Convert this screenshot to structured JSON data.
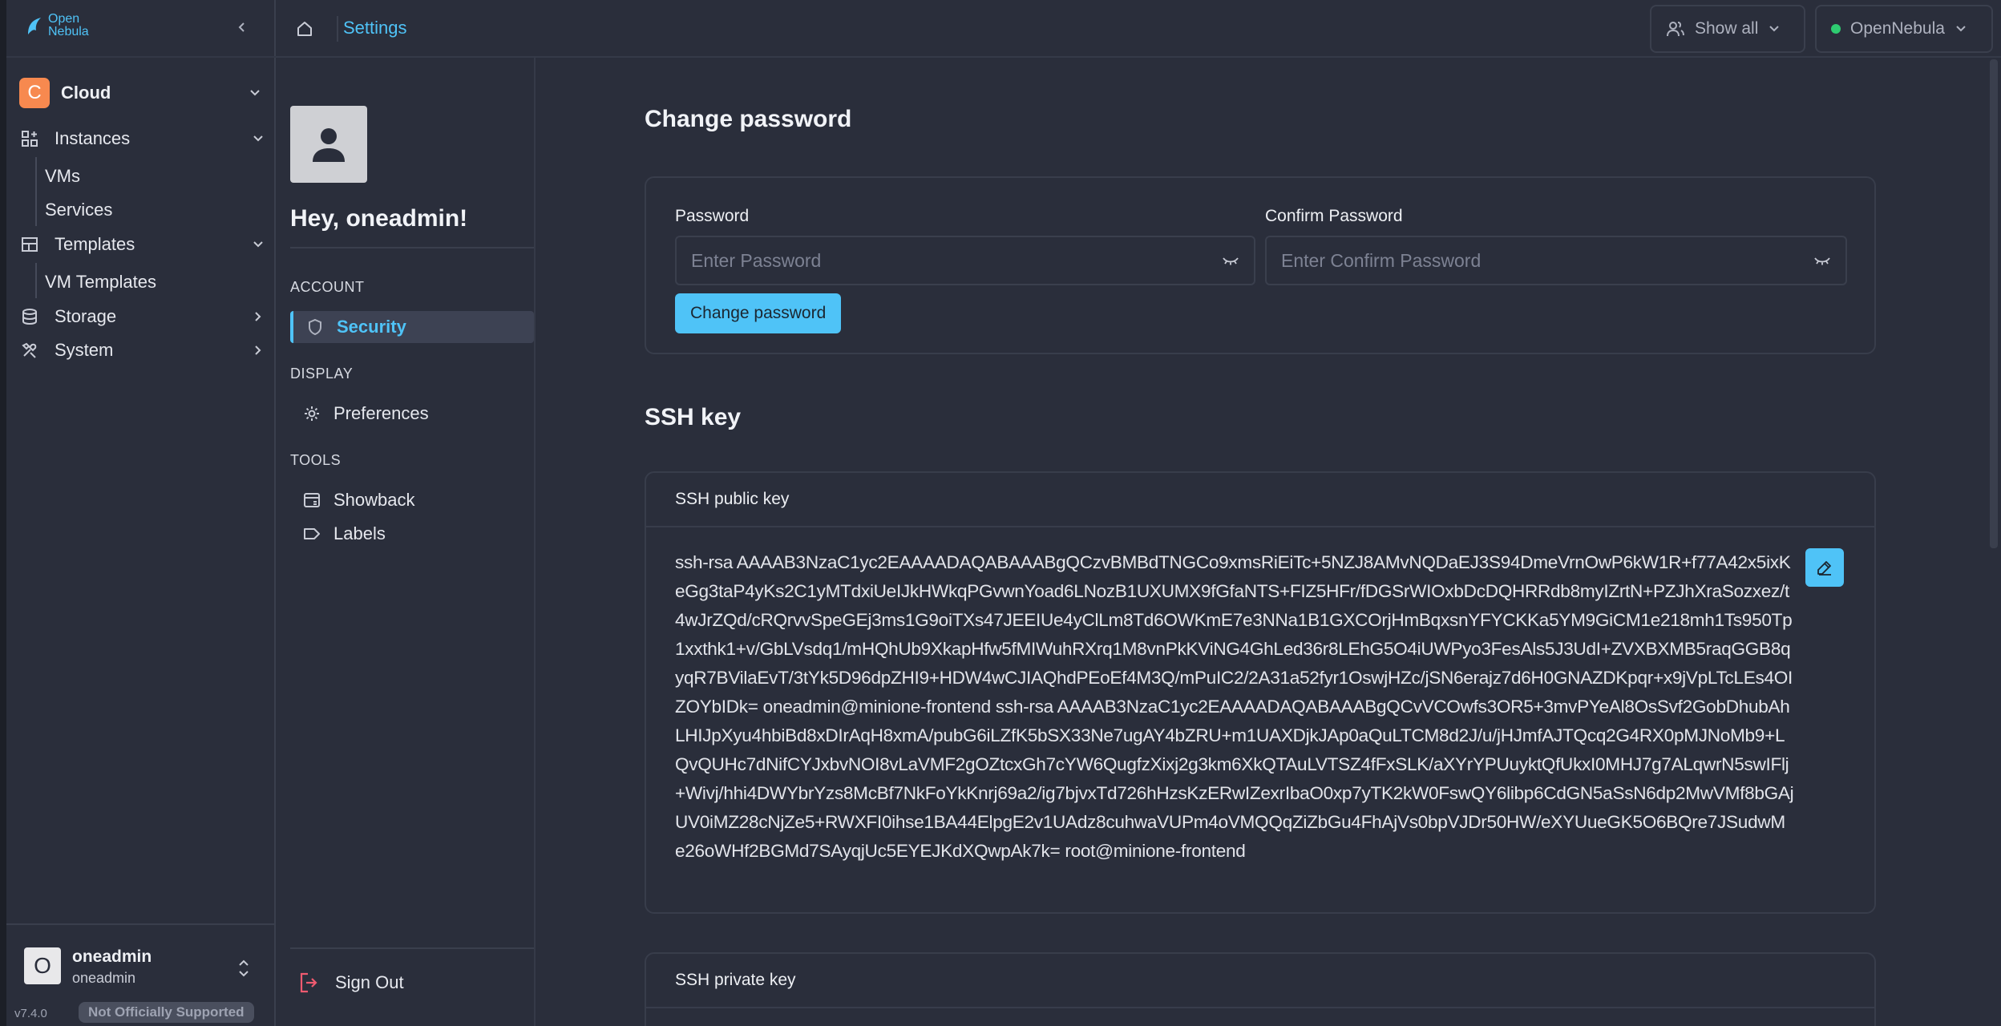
{
  "app": {
    "logo_text_line1": "Open",
    "logo_text_line2": "Nebula",
    "version": "v7.4.0",
    "support_badge": "Not Officially Supported"
  },
  "nav": {
    "group": {
      "badge": "C",
      "label": "Cloud"
    },
    "items": [
      {
        "label": "Instances",
        "icon": "instances-icon",
        "expanded": true,
        "children": [
          "VMs",
          "Services"
        ]
      },
      {
        "label": "Templates",
        "icon": "templates-icon",
        "expanded": true,
        "children": [
          "VM Templates"
        ]
      },
      {
        "label": "Storage",
        "icon": "storage-icon",
        "expanded": false,
        "children": []
      },
      {
        "label": "System",
        "icon": "system-icon",
        "expanded": false,
        "children": []
      }
    ]
  },
  "user": {
    "avatar_letter": "O",
    "name": "oneadmin",
    "group": "oneadmin"
  },
  "topbar": {
    "breadcrumb": "Settings",
    "filter_label": "Show all",
    "zone_label": "OpenNebula",
    "zone_status_color": "#2ecc71"
  },
  "settings_sidebar": {
    "greeting": "Hey, oneadmin!",
    "sections": [
      {
        "label": "ACCOUNT",
        "items": [
          {
            "label": "Security",
            "icon": "shield-icon",
            "active": true
          }
        ]
      },
      {
        "label": "DISPLAY",
        "items": [
          {
            "label": "Preferences",
            "icon": "gear-icon",
            "active": false
          }
        ]
      },
      {
        "label": "TOOLS",
        "items": [
          {
            "label": "Showback",
            "icon": "showback-icon",
            "active": false
          },
          {
            "label": "Labels",
            "icon": "label-icon",
            "active": false
          }
        ]
      }
    ],
    "sign_out": "Sign Out"
  },
  "password": {
    "title": "Change password",
    "password_label": "Password",
    "password_placeholder": "Enter Password",
    "confirm_label": "Confirm Password",
    "confirm_placeholder": "Enter Confirm Password",
    "submit_label": "Change password"
  },
  "ssh": {
    "title": "SSH key",
    "public_key_header": "SSH public key",
    "public_key_value": "ssh-rsa AAAAB3NzaC1yc2EAAAADAQABAAABgQCzvBMBdTNGCo9xmsRiEiTc+5NZJ8AMvNQDaEJ3S94DmeVrnOwP6kW1R+f77A42x5ixKeGg3taP4yKs2C1yMTdxiUeIJkHWkqPGvwnYoad6LNozB1UXUMX9fGfaNTS+FIZ5HFr/fDGSrWIOxbDcDQHRRdb8myIZrtN+PZJhXraSozxez/t4wJrZQd/cRQrvvSpeGEj3ms1G9oiTXs47JEEIUe4yClLm8Td6OWKmE7e3NNa1B1GXCOrjHmBqxsnYFYCKKa5YM9GiCM1e218mh1Ts950Tp1xxthk1+v/GbLVsdq1/mHQhUb9XkapHfw5fMIWuhRXrq1M8vnPkKViNG4GhLed36r8LEhG5O4iUWPyo3FesAls5J3UdI+ZVXBXMB5raqGGB8qyqR7BVilaEvT/3tYk5D96dpZHI9+HDW4wCJIAQhdPEoEf4M3Q/mPuIC2/2A31a52fyr1OswjHZc/jSN6erajz7d6H0GNAZDKpqr+x9jVpLTcLEs4OIZOYbIDk= oneadmin@minione-frontend ssh-rsa AAAAB3NzaC1yc2EAAAADAQABAAABgQCvVCOwfs3OR5+3mvPYeAl8OsSvf2GobDhubAhLHIJpXyu4hbiBd8xDIrAqH8xmA/pubG6iLZfK5bSX33Ne7ugAY4bZRU+m1UAXDjkJAp0aQuLTCM8d2J/u/jHJmfAJTQcq2G4RX0pMJNoMb9+LQvQUHc7dNifCYJxbvNOI8vLaVMF2gOZtcxGh7cYW6QugfzXixj2g3km6XkQTAuLVTSZ4fFxSLK/aXYrYPUuyktQfUkxI0MHJ7g7ALqwrN5swIFlj+Wivj/hhi4DWYbrYzs8McBf7NkFoYkKnrj69a2/ig7bjvxTd726hHzsKzERwIZexrIbaO0xp7yTK2kW0FswQY6libp6CdGN5aSsN6dp2MwVMf8bGAjUV0iMZ28cNjZe5+RWXFI0ihse1BA44ElpgE2v1UAdz8cuhwaVUPm4oVMQQqZiZbGu4FhAjVs0bpVJDr50HW/eXYUueGK5O6BQre7JSudwMe26oWHf2BGMd7SAyqjUc5EYEJKdXQwpAk7k= root@minione-frontend",
    "private_key_header": "SSH private key"
  }
}
